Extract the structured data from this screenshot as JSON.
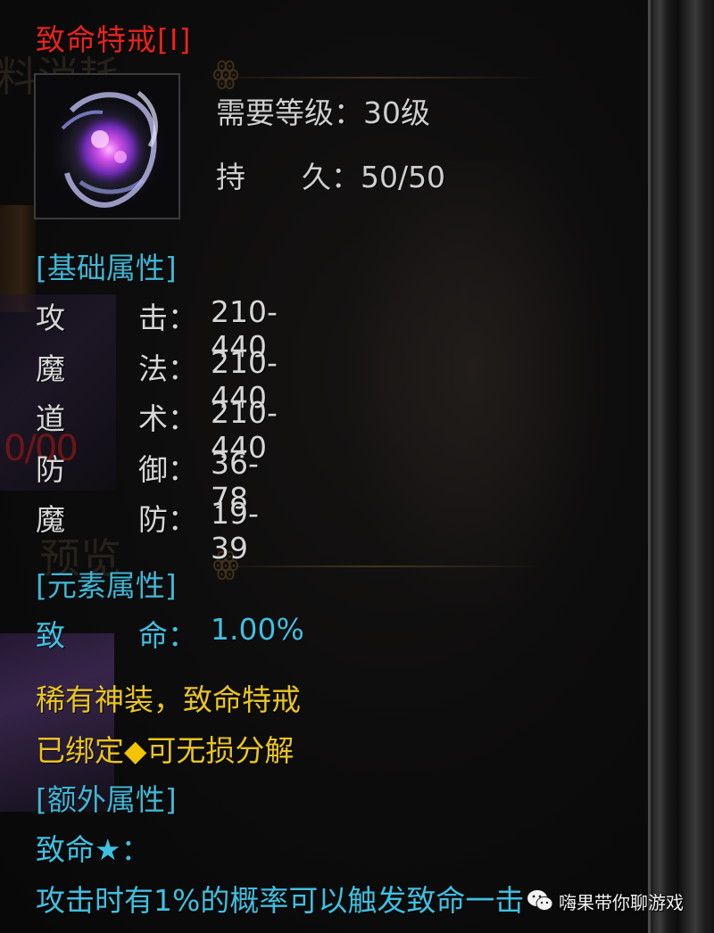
{
  "item": {
    "name": "致命特戒[I]",
    "icon": "purple-crystal-ring-icon",
    "requirements": [
      {
        "label": "需要等级：",
        "value": "30级"
      },
      {
        "label": "持      久：",
        "value": "50/50"
      }
    ]
  },
  "base_attributes": {
    "header": "[基础属性]",
    "rows": [
      {
        "c1": "攻",
        "c2": "击",
        "colon": "：",
        "value": "210-440"
      },
      {
        "c1": "魔",
        "c2": "法",
        "colon": "：",
        "value": "210-440"
      },
      {
        "c1": "道",
        "c2": "术",
        "colon": "：",
        "value": "210-440"
      },
      {
        "c1": "防",
        "c2": "御",
        "colon": "：",
        "value": "36-78"
      },
      {
        "c1": "魔",
        "c2": "防",
        "colon": "：",
        "value": "19-39"
      }
    ]
  },
  "element_attributes": {
    "header": "[元素属性]",
    "rows": [
      {
        "c1": "致",
        "c2": "命",
        "colon": "：",
        "value": "1.00%"
      }
    ]
  },
  "notes": {
    "rarity": "稀有神装，致命特戒",
    "bound_prefix": "已绑定",
    "bound_symbol": "◆",
    "bound_suffix": "可无损分解"
  },
  "extra_attributes": {
    "header": "[额外属性]",
    "effect_name": "致命★：",
    "effect_desc": "攻击时有1%的概率可以触发致命一击"
  },
  "background_scene": {
    "ghost_text_1": "料消耗",
    "ghost_text_2": "预览",
    "red_number": "0/00"
  },
  "watermark": {
    "icon": "wechat-icon",
    "text": "嗨果带你聊游戏"
  },
  "colors": {
    "title_red": "#e8231e",
    "section_cyan": "#3fb6d4",
    "value_white": "#d6d6d6",
    "note_yellow": "#e9c41e"
  }
}
